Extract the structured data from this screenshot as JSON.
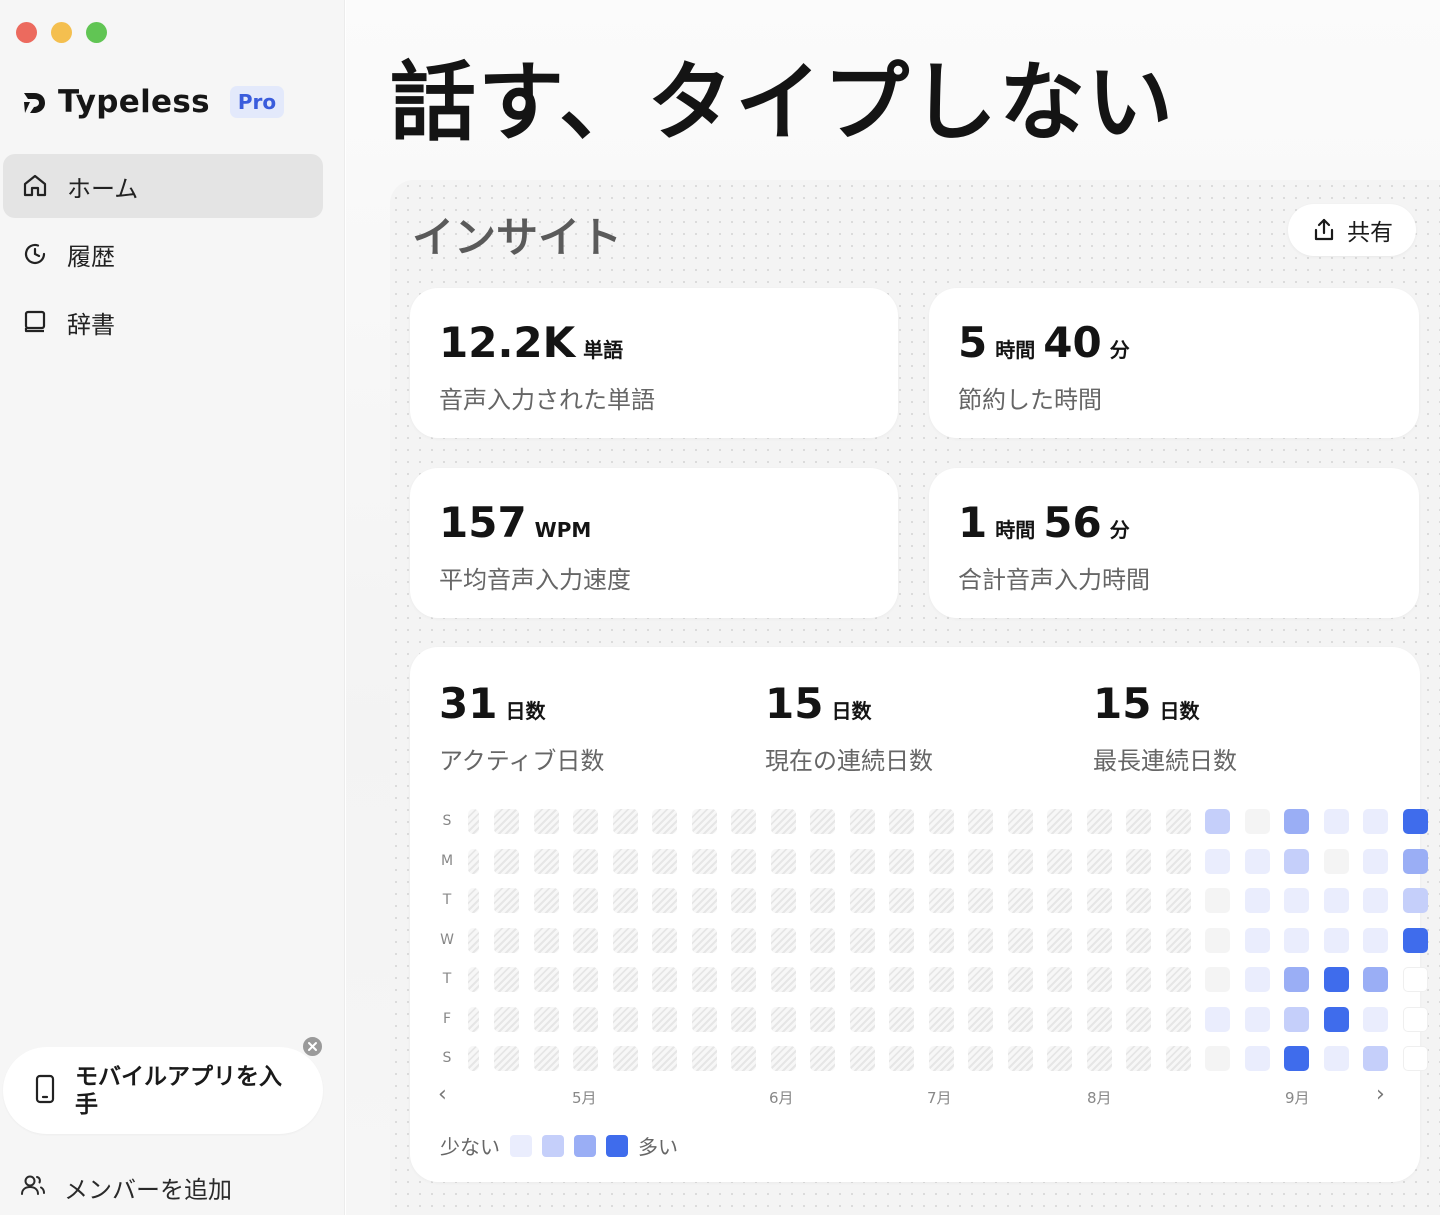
{
  "sidebar": {
    "brand": "Typeless",
    "badge": "Pro",
    "nav": [
      {
        "label": "ホーム",
        "icon": "home-icon",
        "active": true
      },
      {
        "label": "履歴",
        "icon": "history-icon",
        "active": false
      },
      {
        "label": "辞書",
        "icon": "dictionary-icon",
        "active": false
      }
    ],
    "promo": {
      "text": "モバイルアプリを入手",
      "icon": "phone-icon"
    },
    "add_member": "メンバーを追加"
  },
  "main": {
    "title": "話す、タイプしない",
    "insights": {
      "title": "インサイト",
      "share": "共有",
      "stats": [
        {
          "parts": [
            {
              "num": "12.2K",
              "unit": "単語"
            }
          ],
          "label": "音声入力された単語"
        },
        {
          "parts": [
            {
              "num": "5",
              "unit": "時間"
            },
            {
              "num": "40",
              "unit": "分"
            }
          ],
          "label": "節約した時間"
        },
        {
          "parts": [
            {
              "num": "157",
              "unit": "WPM"
            }
          ],
          "label": "平均音声入力速度"
        },
        {
          "parts": [
            {
              "num": "1",
              "unit": "時間"
            },
            {
              "num": "56",
              "unit": "分"
            }
          ],
          "label": "合計音声入力時間"
        }
      ],
      "streaks": [
        {
          "num": "31",
          "unit": "日数",
          "label": "アクティブ日数"
        },
        {
          "num": "15",
          "unit": "日数",
          "label": "現在の連続日数"
        },
        {
          "num": "15",
          "unit": "日数",
          "label": "最長連続日数"
        }
      ],
      "heatmap": {
        "day_labels": [
          "S",
          "M",
          "T",
          "W",
          "T",
          "F",
          "S"
        ],
        "month_labels": [
          "5月",
          "6月",
          "7月",
          "8月",
          "9月"
        ],
        "prev": "‹",
        "next": "›",
        "active_weeks": [
          [
            2,
            1,
            0,
            0,
            0,
            1,
            0
          ],
          [
            0,
            1,
            1,
            1,
            1,
            1,
            1
          ],
          [
            3,
            2,
            1,
            1,
            3,
            2,
            4
          ],
          [
            1,
            0,
            1,
            1,
            4,
            4,
            1
          ],
          [
            1,
            1,
            1,
            1,
            3,
            1,
            2
          ],
          [
            4,
            3,
            2,
            4,
            -1,
            -1,
            -1
          ]
        ],
        "level_colors": [
          "#f4f4f4",
          "#eaedfd",
          "#c5cffa",
          "#9aaef5",
          "#3f6cec"
        ],
        "legend": {
          "less": "少ない",
          "more": "多い"
        }
      }
    }
  }
}
